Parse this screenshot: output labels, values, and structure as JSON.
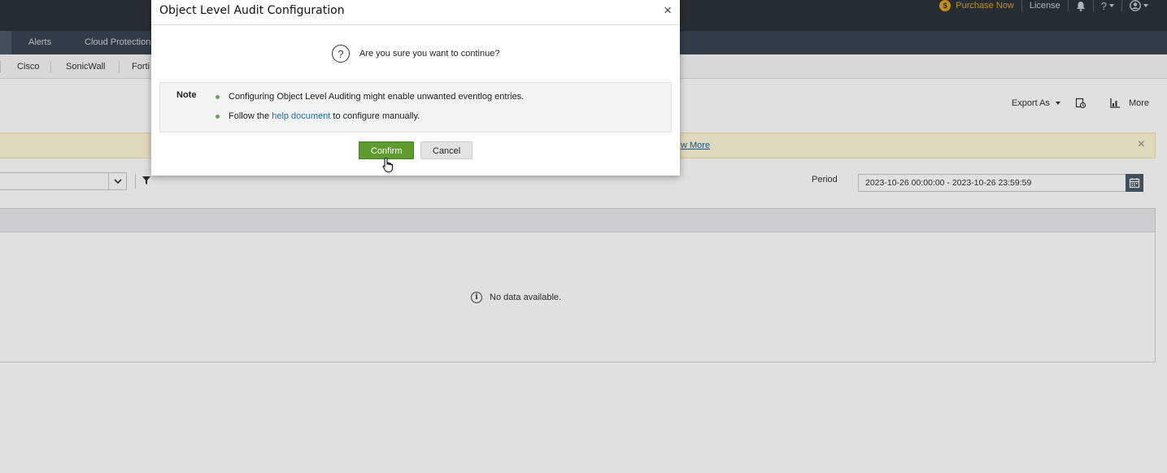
{
  "topbar": {
    "purchase_label": "Purchase Now",
    "license_label": "License",
    "help_symbol": "?"
  },
  "nav": {
    "tabs": [
      "Alerts",
      "Cloud Protection"
    ]
  },
  "subnav": {
    "items": [
      "Cisco",
      "SonicWall",
      "Forti"
    ]
  },
  "toolbar": {
    "export_label": "Export As",
    "more_label": "More"
  },
  "banner": {
    "link_text": "w More",
    "close_symbol": "×"
  },
  "filters": {
    "period_label": "Period",
    "period_value": "2023-10-26 00:00:00 - 2023-10-26 23:59:59"
  },
  "grid": {
    "empty_text": "No data available."
  },
  "modal": {
    "title": "Object Level Audit Configuration",
    "close_symbol": "×",
    "question": "Are you sure you want to continue?",
    "note_label": "Note",
    "note_1": "Configuring Object Level Auditing might enable unwanted eventlog entries.",
    "note_2_prefix": "Follow the ",
    "note_2_link": "help document",
    "note_2_suffix": " to configure manually.",
    "confirm_label": "Confirm",
    "cancel_label": "Cancel"
  },
  "colors": {
    "topbar": "#2b343b",
    "navbar": "#3a4550",
    "accent_green": "#5f9b2f",
    "link_blue": "#1f6fb2",
    "purchase_gold": "#e0a316",
    "banner_bg": "#fdf6d8"
  }
}
